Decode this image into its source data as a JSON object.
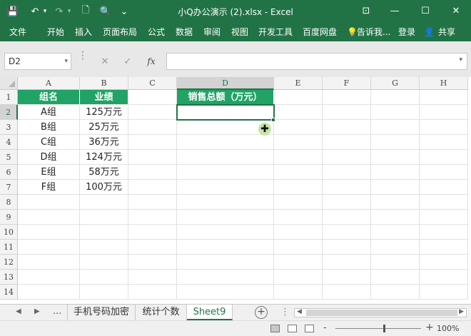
{
  "titlebar": {
    "title": "小Q办公演示 (2).xlsx - Excel",
    "save_icon": "💾",
    "undo_icon": "↶",
    "undo_dropdown": "▾",
    "redo_icon": "↷",
    "redo_dropdown": "▾",
    "new_icon": "🗋",
    "preview_icon": "🔍",
    "more_icon": "⌄",
    "ribbon_options_icon": "⊡",
    "minimize": "—",
    "maximize": "☐",
    "close": "✕"
  },
  "ribbon": {
    "tabs": [
      "文件",
      "开始",
      "插入",
      "页面布局",
      "公式",
      "数据",
      "审阅",
      "视图",
      "开发工具",
      "百度网盘"
    ],
    "tellme": "告诉我...",
    "tellme_icon": "💡",
    "login": "登录",
    "share": "共享",
    "share_icon": "👤"
  },
  "formula_bar": {
    "name_box": "D2",
    "name_dropdown": "▾",
    "cancel_icon": "✕",
    "enter_icon": "✓",
    "fx_label": "fx",
    "formula_value": "",
    "expand_icon": "▾"
  },
  "grid": {
    "columns": [
      "A",
      "B",
      "C",
      "D",
      "E",
      "F",
      "G",
      "H"
    ],
    "rows": [
      "1",
      "2",
      "3",
      "4",
      "5",
      "6",
      "7",
      "8",
      "9",
      "10",
      "11",
      "12",
      "13",
      "14"
    ],
    "selected_cell": "D2",
    "header_group": "组名",
    "header_sales": "业绩",
    "header_total": "销售总额（万元）",
    "data": [
      {
        "group": "A组",
        "sales": "125万元"
      },
      {
        "group": "B组",
        "sales": "25万元"
      },
      {
        "group": "C组",
        "sales": "36万元"
      },
      {
        "group": "D组",
        "sales": "124万元"
      },
      {
        "group": "E组",
        "sales": "58万元"
      },
      {
        "group": "F组",
        "sales": "100万元"
      }
    ],
    "header_color": "#21A366",
    "accent_color": "#217346"
  },
  "sheet_tabs": {
    "prev": "◀",
    "next": "▶",
    "more": "...",
    "tabs": [
      "手机号码加密",
      "统计个数",
      "Sheet9"
    ],
    "active": "Sheet9",
    "add_icon": "+",
    "options_icon": "⋮"
  },
  "status_bar": {
    "zoom_minus": "-",
    "zoom_plus": "+",
    "zoom": "100%"
  }
}
